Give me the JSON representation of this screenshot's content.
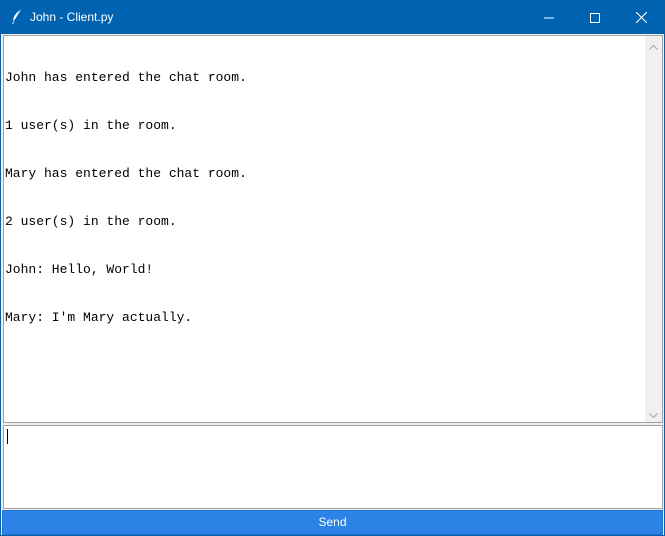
{
  "window": {
    "title": "John - Client.py",
    "colors": {
      "titlebar": "#0063b1",
      "send_button": "#2b83e6"
    },
    "icons": {
      "app": "feather-icon",
      "minimize": "minimize-icon",
      "maximize": "maximize-icon",
      "close": "close-icon"
    }
  },
  "chat": {
    "messages": [
      "John has entered the chat room.",
      "1 user(s) in the room.",
      "Mary has entered the chat room.",
      "2 user(s) in the room.",
      "John: Hello, World!",
      "Mary: I'm Mary actually."
    ]
  },
  "input": {
    "value": ""
  },
  "send": {
    "label": "Send"
  }
}
